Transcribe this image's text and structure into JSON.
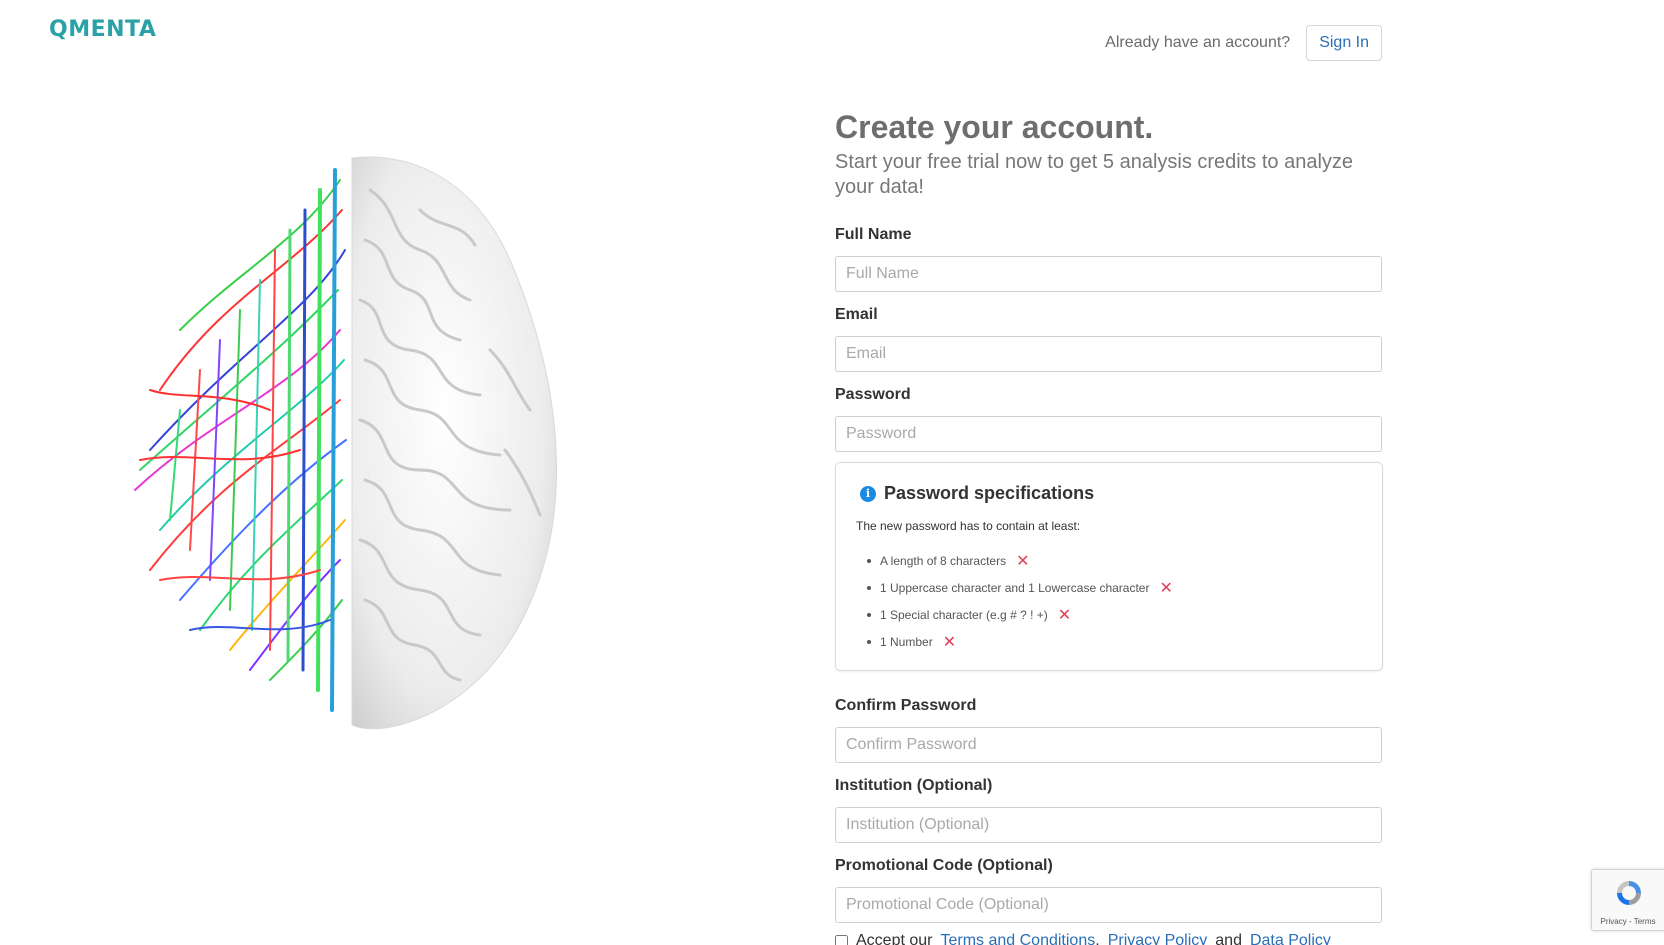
{
  "brand": {
    "logo_text": "QMENTA"
  },
  "header": {
    "already_text": "Already have an account?",
    "signin_label": "Sign In"
  },
  "form": {
    "title": "Create your account.",
    "subtitle": "Start your free trial now to get 5 analysis credits to analyze your data!",
    "fields": {
      "full_name": {
        "label": "Full Name",
        "placeholder": "Full Name"
      },
      "email": {
        "label": "Email",
        "placeholder": "Email"
      },
      "password": {
        "label": "Password",
        "placeholder": "Password"
      },
      "confirm_password": {
        "label": "Confirm Password",
        "placeholder": "Confirm Password"
      },
      "institution": {
        "label": "Institution (Optional)",
        "placeholder": "Institution (Optional)"
      },
      "promo": {
        "label": "Promotional Code (Optional)",
        "placeholder": "Promotional Code (Optional)"
      }
    }
  },
  "password_specs": {
    "title": "Password specifications",
    "description": "The new password has to contain at least:",
    "items": [
      "A length of 8 characters",
      "1 Uppercase character and 1 Lowercase character",
      "1 Special character (e.g # ? ! +)",
      "1 Number"
    ],
    "status_icon": "close-icon",
    "status_color": "#e0405a"
  },
  "terms": {
    "accept_text": "Accept our",
    "terms_link": "Terms and Conditions",
    "comma": ",",
    "privacy_link": "Privacy Policy",
    "and_text": "and",
    "data_link": "Data Policy"
  },
  "recaptcha": {
    "footer_text": "Privacy - Terms"
  },
  "colors": {
    "brand": "#2aa1a6",
    "link": "#2a6fb5",
    "info": "#1a8be0"
  }
}
